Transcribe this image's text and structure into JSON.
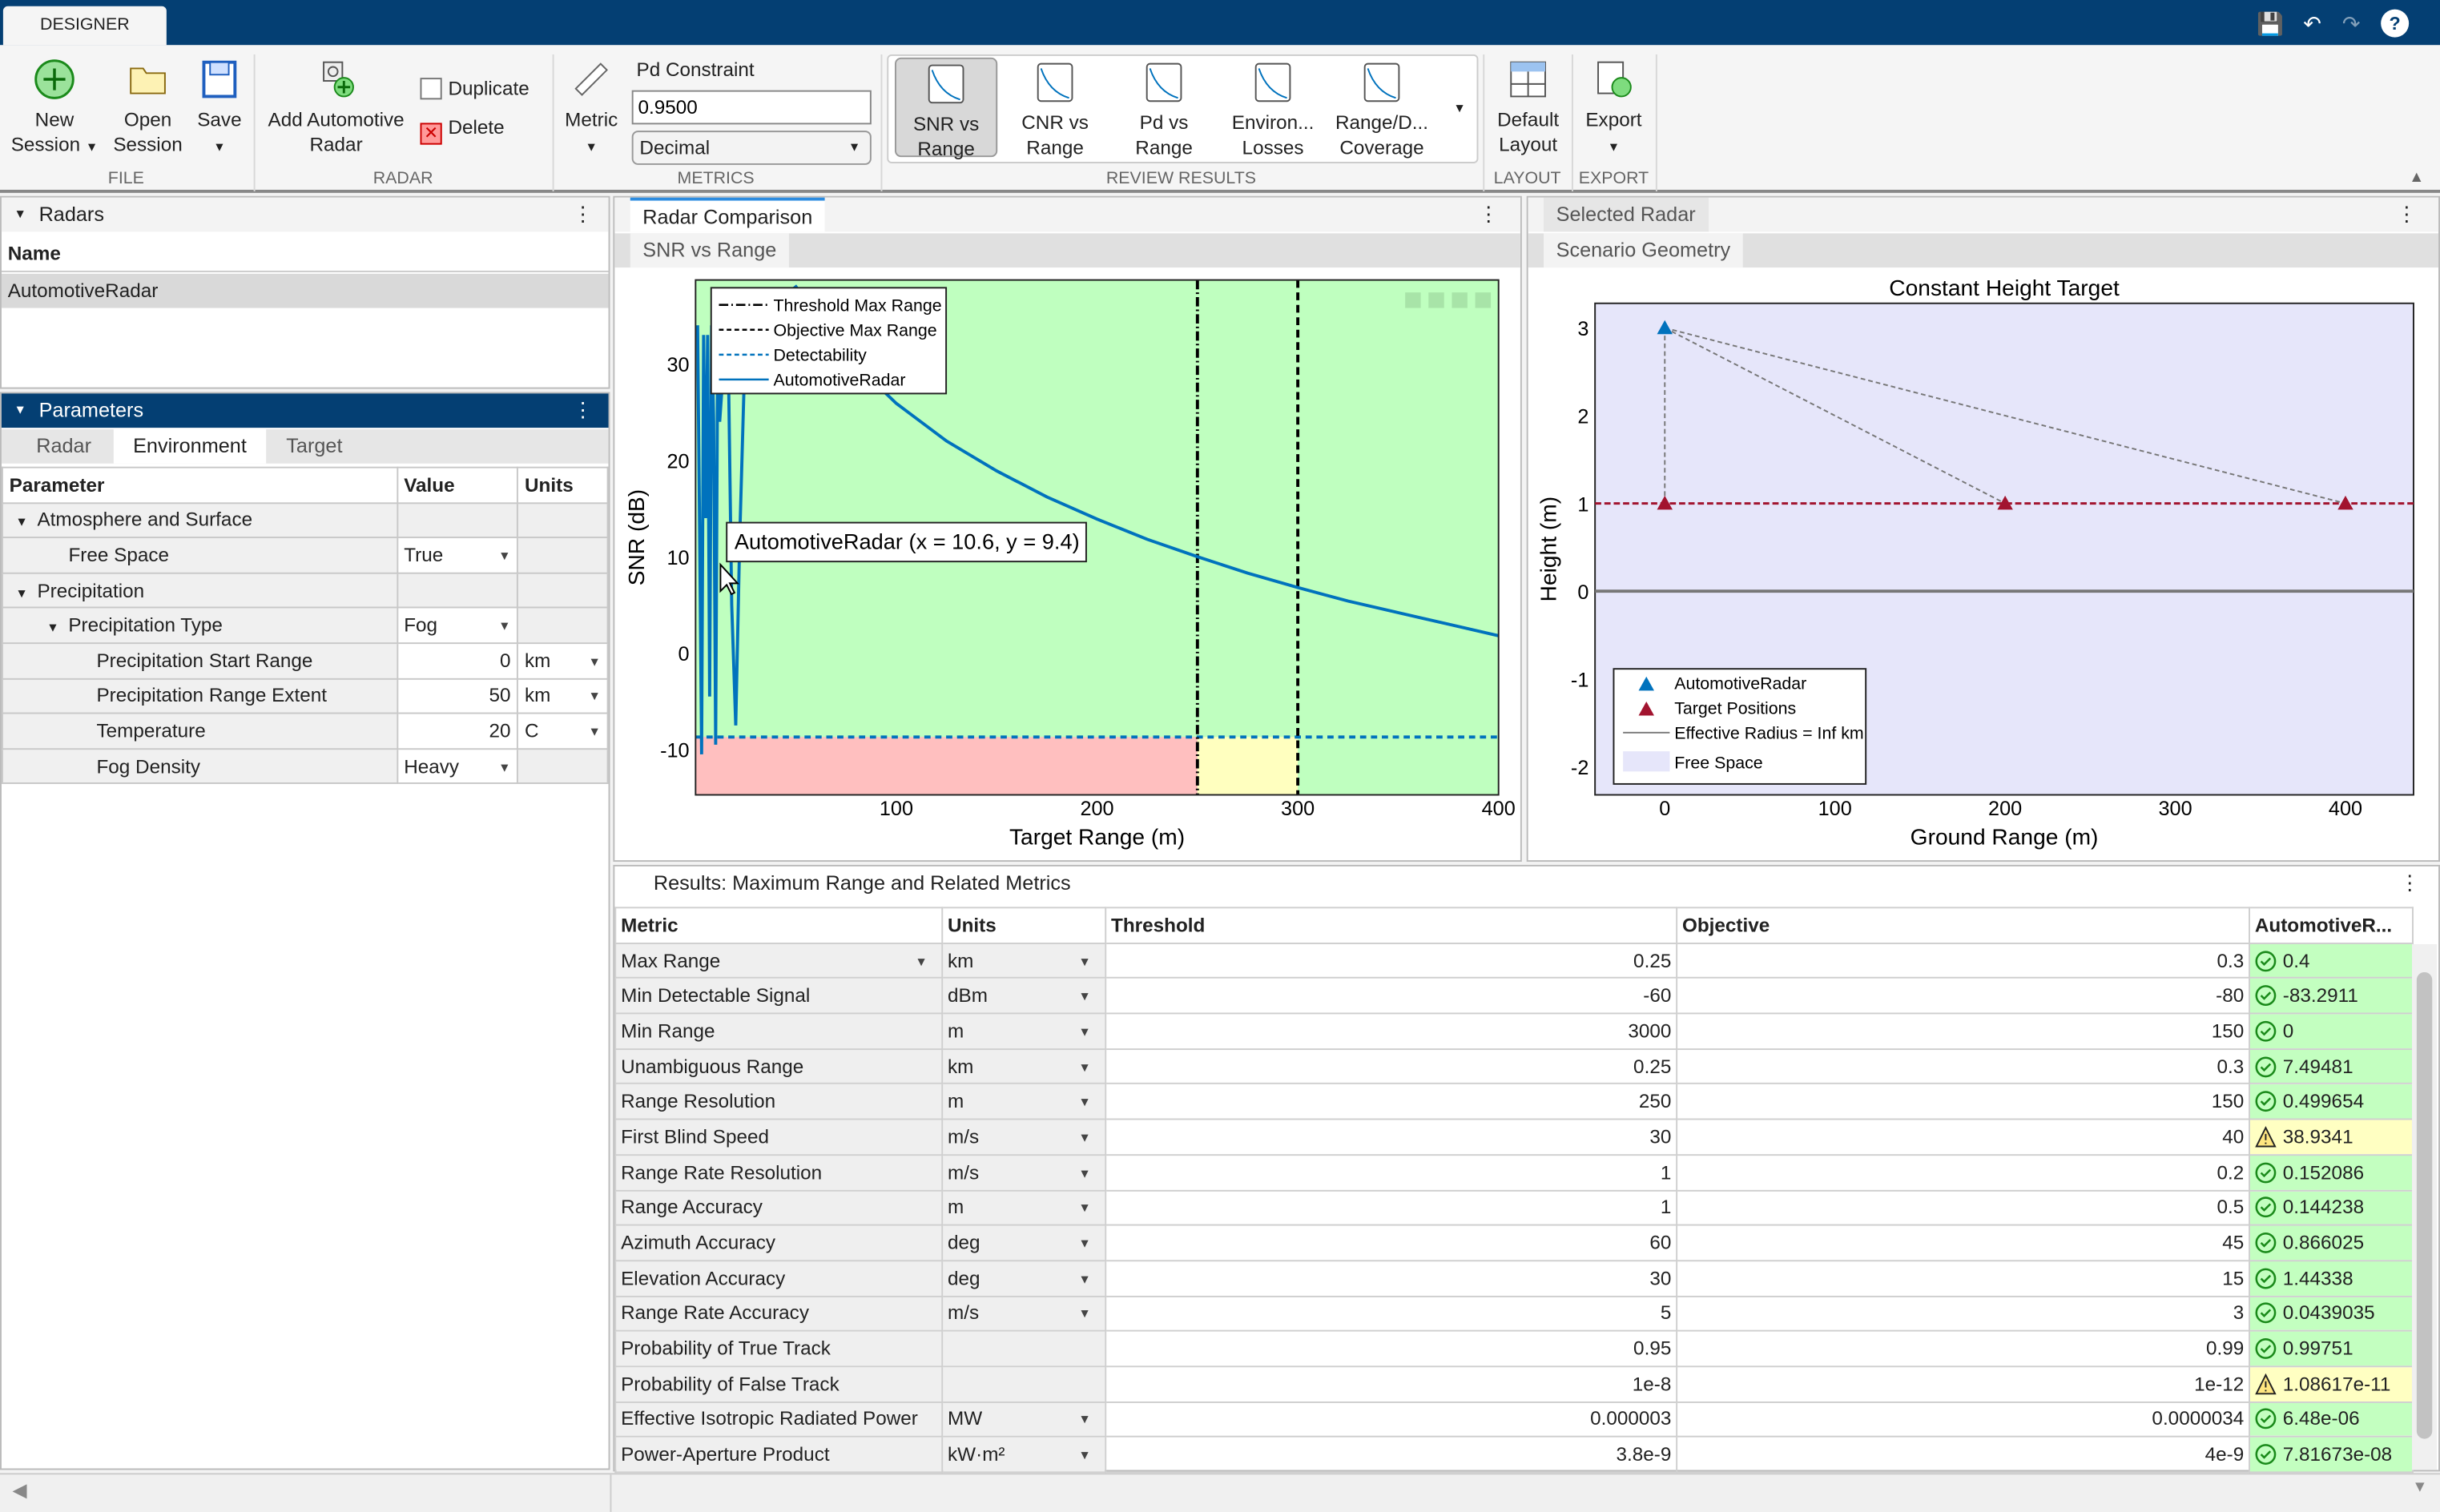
{
  "titlebar": {
    "tab": "DESIGNER"
  },
  "ribbon": {
    "file": {
      "new_session": [
        "New",
        "Session"
      ],
      "open_session": [
        "Open",
        "Session"
      ],
      "save": "Save",
      "label": "FILE"
    },
    "radar": {
      "add": [
        "Add Automotive",
        "Radar"
      ],
      "duplicate": "Duplicate",
      "delete": "Delete",
      "label": "RADAR"
    },
    "metrics": {
      "metric": "Metric",
      "pd_label": "Pd Constraint",
      "pd_value": "0.9500",
      "format": "Decimal",
      "label": "METRICS"
    },
    "review": {
      "items": [
        [
          "SNR vs",
          "Range"
        ],
        [
          "CNR vs",
          "Range"
        ],
        [
          "Pd vs",
          "Range"
        ],
        [
          "Environ...",
          "Losses"
        ],
        [
          "Range/D...",
          "Coverage"
        ]
      ],
      "label": "REVIEW RESULTS",
      "selected": 0
    },
    "layout": {
      "default": [
        "Default",
        "Layout"
      ],
      "label": "LAYOUT"
    },
    "export": {
      "export": "Export",
      "label": "EXPORT"
    }
  },
  "radars": {
    "title": "Radars",
    "col": "Name",
    "items": [
      "AutomotiveRadar"
    ]
  },
  "parameters": {
    "title": "Parameters",
    "tabs": [
      "Radar",
      "Environment",
      "Target"
    ],
    "active_tab": 1,
    "headers": [
      "Parameter",
      "Value",
      "Units"
    ],
    "rows": [
      {
        "name": "Atmosphere and Surface",
        "level": 0,
        "group": true
      },
      {
        "name": "Free Space",
        "level": 1,
        "value": "True",
        "value_dd": true
      },
      {
        "name": "Precipitation",
        "level": 0,
        "group": true
      },
      {
        "name": "Precipitation Type",
        "level": 1,
        "value": "Fog",
        "value_dd": true,
        "group": true
      },
      {
        "name": "Precipitation Start Range",
        "level": 2,
        "value": "0",
        "unit": "km",
        "num": true
      },
      {
        "name": "Precipitation Range Extent",
        "level": 2,
        "value": "50",
        "unit": "km",
        "num": true
      },
      {
        "name": "Temperature",
        "level": 2,
        "value": "20",
        "unit": "C",
        "num": true
      },
      {
        "name": "Fog Density",
        "level": 2,
        "value": "Heavy",
        "value_dd": true
      }
    ]
  },
  "comparison": {
    "tab": "Radar Comparison",
    "subtab": "SNR vs Range"
  },
  "selected": {
    "tab": "Selected Radar",
    "subtab": "Scenario Geometry"
  },
  "chart_data": [
    {
      "type": "line",
      "title": "",
      "xlabel": "Target Range (m)",
      "ylabel": "SNR (dB)",
      "xlim": [
        0,
        400
      ],
      "ylim": [
        -14.7,
        38.7
      ],
      "xticks": [
        100,
        200,
        300,
        400
      ],
      "yticks": [
        -10,
        0,
        10,
        20,
        30
      ],
      "legend": [
        "Threshold Max Range",
        "Objective Max Range",
        "Detectability",
        "AutomotiveRadar"
      ],
      "legend_position": "top-left",
      "threshold_max_range": 250,
      "objective_max_range": 300,
      "detectability": -8.7,
      "region_colors": {
        "pass": "#bfffbf",
        "fail": "#ffbfbf",
        "between": "#ffffbf"
      },
      "series": [
        {
          "name": "AutomotiveRadar",
          "color": "#0072bd",
          "x": [
            1,
            2,
            3,
            4,
            5,
            6,
            7,
            8,
            9,
            10,
            11,
            12,
            14,
            16,
            18,
            20,
            22,
            25,
            50,
            75,
            100,
            125,
            150,
            175,
            200,
            225,
            250,
            275,
            300,
            325,
            350,
            375,
            400
          ],
          "y": [
            34,
            13,
            -10.5,
            33,
            14,
            33,
            -4.5,
            34,
            24,
            -9.5,
            32,
            24,
            30,
            35,
            5,
            -7.5,
            12,
            34,
            38,
            30.9,
            25.9,
            22.0,
            18.9,
            16.2,
            13.9,
            11.8,
            10,
            8.3,
            6.8,
            5.4,
            4.2,
            3.0,
            1.8
          ]
        }
      ],
      "datatip": "AutomotiveRadar (x = 10.6, y = 9.4)"
    },
    {
      "type": "scatter",
      "title": "Constant Height Target",
      "xlabel": "Ground Range (m)",
      "ylabel": "Height (m)",
      "xlim": [
        -41,
        440
      ],
      "ylim": [
        -2.32,
        3.28
      ],
      "xticks": [
        0,
        100,
        200,
        300,
        400
      ],
      "yticks": [
        -2,
        -1,
        0,
        1,
        2,
        3
      ],
      "background": "#e6e6fa",
      "legend_position": "bottom-left",
      "legend": [
        "AutomotiveRadar",
        "Target Positions",
        "Effective Radius = Inf km",
        "Free Space"
      ],
      "radar": {
        "x": 0,
        "y": 3,
        "color": "#0072bd"
      },
      "targets": {
        "x": [
          0,
          200,
          400
        ],
        "y": [
          1,
          1,
          1
        ],
        "color": "#a2142f"
      },
      "target_height": 1,
      "surface": 0
    }
  ],
  "results": {
    "title": "Results: Maximum Range and Related Metrics",
    "headers": [
      "Metric",
      "Units",
      "Threshold",
      "Objective",
      "AutomotiveR..."
    ],
    "rows": [
      {
        "metric": "Max Range",
        "units": "km",
        "threshold": "0.25",
        "objective": "0.3",
        "value": "0.4",
        "status": "ok",
        "metric_dd": true
      },
      {
        "metric": "Min Detectable Signal",
        "units": "dBm",
        "threshold": "-60",
        "objective": "-80",
        "value": "-83.2911",
        "status": "ok"
      },
      {
        "metric": "Min Range",
        "units": "m",
        "threshold": "3000",
        "objective": "150",
        "value": "0",
        "status": "ok"
      },
      {
        "metric": "Unambiguous Range",
        "units": "km",
        "threshold": "0.25",
        "objective": "0.3",
        "value": "7.49481",
        "status": "ok"
      },
      {
        "metric": "Range Resolution",
        "units": "m",
        "threshold": "250",
        "objective": "150",
        "value": "0.499654",
        "status": "ok"
      },
      {
        "metric": "First Blind Speed",
        "units": "m/s",
        "threshold": "30",
        "objective": "40",
        "value": "38.9341",
        "status": "warn"
      },
      {
        "metric": "Range Rate Resolution",
        "units": "m/s",
        "threshold": "1",
        "objective": "0.2",
        "value": "0.152086",
        "status": "ok"
      },
      {
        "metric": "Range Accuracy",
        "units": "m",
        "threshold": "1",
        "objective": "0.5",
        "value": "0.144238",
        "status": "ok"
      },
      {
        "metric": "Azimuth Accuracy",
        "units": "deg",
        "threshold": "60",
        "objective": "45",
        "value": "0.866025",
        "status": "ok"
      },
      {
        "metric": "Elevation Accuracy",
        "units": "deg",
        "threshold": "30",
        "objective": "15",
        "value": "1.44338",
        "status": "ok"
      },
      {
        "metric": "Range Rate Accuracy",
        "units": "m/s",
        "threshold": "5",
        "objective": "3",
        "value": "0.0439035",
        "status": "ok"
      },
      {
        "metric": "Probability of True Track",
        "units": "",
        "threshold": "0.95",
        "objective": "0.99",
        "value": "0.99751",
        "status": "ok"
      },
      {
        "metric": "Probability of False Track",
        "units": "",
        "threshold": "1e-8",
        "objective": "1e-12",
        "value": "1.08617e-11",
        "status": "warn"
      },
      {
        "metric": "Effective Isotropic Radiated Power",
        "units": "MW",
        "threshold": "0.000003",
        "objective": "0.0000034",
        "value": "6.48e-06",
        "status": "ok"
      },
      {
        "metric": "Power-Aperture Product",
        "units": "kW·m²",
        "threshold": "3.8e-9",
        "objective": "4e-9",
        "value": "7.81673e-08",
        "status": "ok"
      }
    ]
  }
}
